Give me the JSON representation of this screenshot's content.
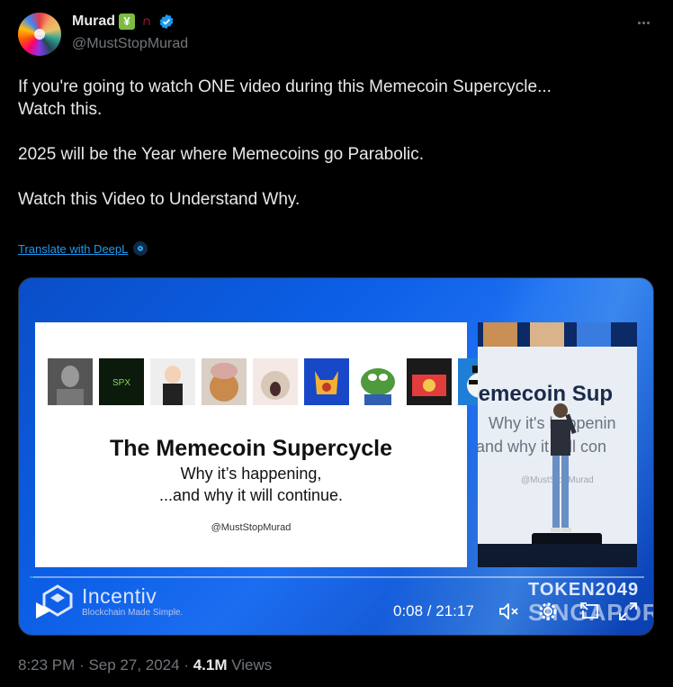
{
  "user": {
    "display_name": "Murad",
    "badge_emojis": [
      "chart-increasing-with-yen",
      "magnet"
    ],
    "handle": "@MustStopMurad",
    "verified_color": "#1d9bf0"
  },
  "tweet": {
    "lines": [
      "If you're going to watch ONE video during this Memecoin Supercycle...",
      "Watch this.",
      "",
      "2025 will be the Year where Memecoins go Parabolic.",
      "",
      "Watch this Video to Understand Why."
    ],
    "translate_label": "Translate with DeepL"
  },
  "video": {
    "slide": {
      "title": "The Memecoin Supercycle",
      "subtitle1": "Why it’s happening,",
      "subtitle2": "...and why it will continue.",
      "handle": "@MustStopMurad"
    },
    "stage_screen": {
      "big": "lemecoin Sup",
      "sub1": "Why it's happenin",
      "sub2": "and why it will con",
      "handle": "@MustStopMurad"
    },
    "sponsor": {
      "name": "Incentiv",
      "tagline": "Blockchain Made Simple."
    },
    "event": {
      "name": "TOKEN2049",
      "city": "SINGAPORE"
    },
    "time": "0:08 / 21:17",
    "progress": 0.0063,
    "accent": "#1d9bf0"
  },
  "meta": {
    "time": "8:23 PM",
    "date": "Sep 27, 2024",
    "views": "4.1M",
    "views_label": "Views"
  }
}
